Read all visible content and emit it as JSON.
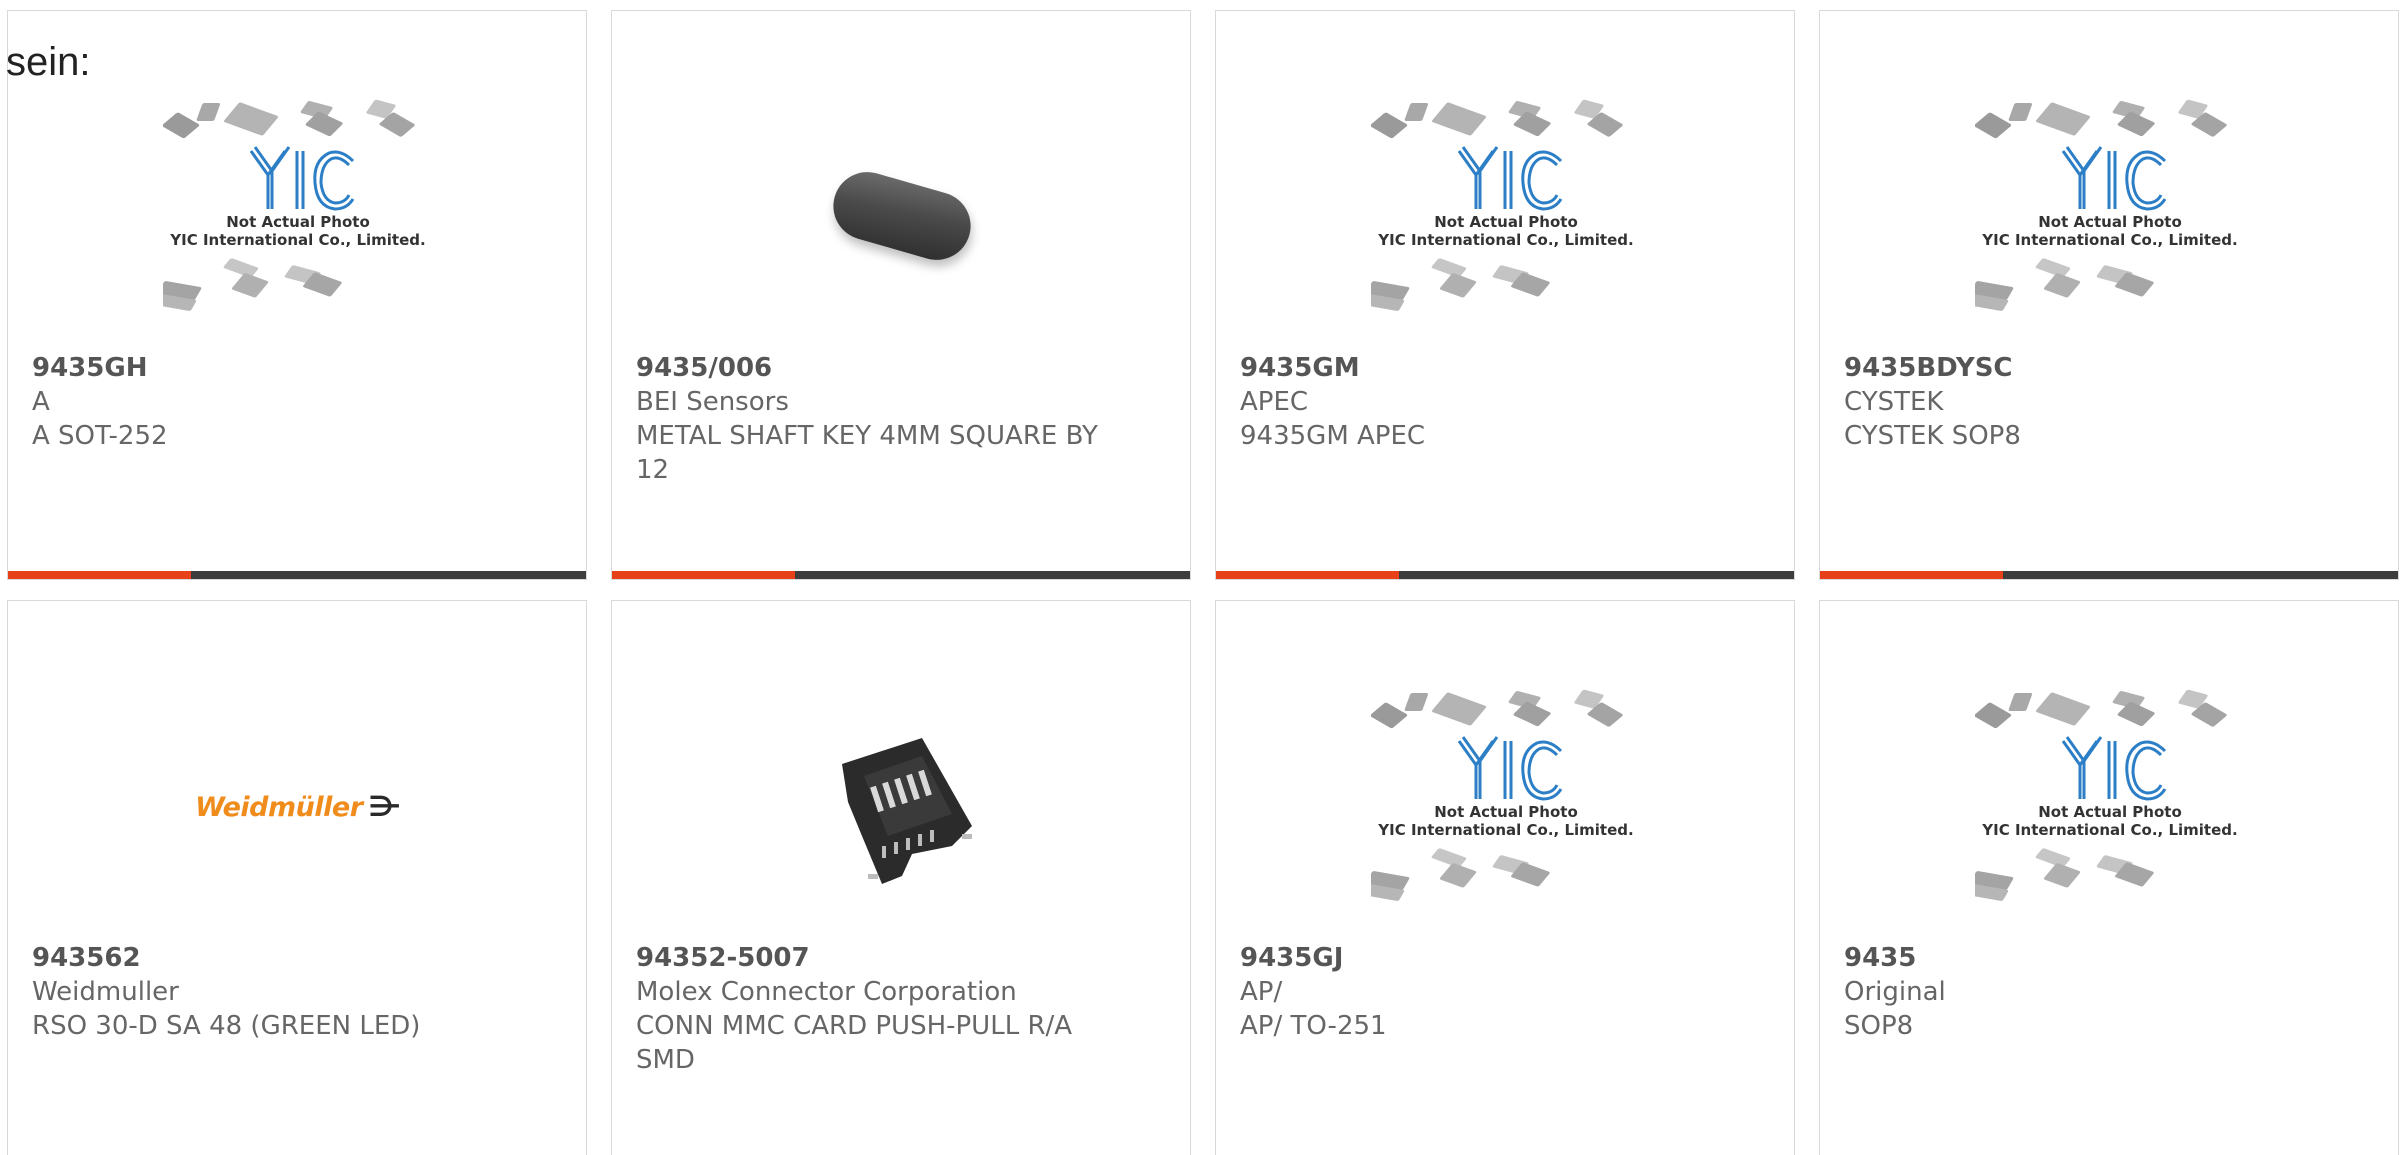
{
  "page": {
    "lead_text": "sein:"
  },
  "placeholder": {
    "line1": "Not Actual Photo",
    "line2": "YIC International Co., Limited.",
    "brand": "YIC"
  },
  "colors": {
    "accent": "#e8411a",
    "bar": "#3d3d3d",
    "text": "#666666"
  },
  "products": [
    {
      "part": "9435GH",
      "maker": "A",
      "desc": "A SOT-252",
      "image": "yic-placeholder"
    },
    {
      "part": "9435/006",
      "maker": "BEI Sensors",
      "desc": "METAL SHAFT KEY 4MM SQUARE BY 12",
      "image": "shaft-key-photo"
    },
    {
      "part": "9435GM",
      "maker": "APEC",
      "desc": "9435GM APEC",
      "image": "yic-placeholder"
    },
    {
      "part": "9435BDYSC",
      "maker": "CYSTEK",
      "desc": "CYSTEK SOP8",
      "image": "yic-placeholder"
    },
    {
      "part": "943562",
      "maker": "Weidmuller",
      "desc": "RSO 30-D SA 48 (GREEN LED)",
      "image": "weidmuller-logo",
      "logo_text": "Weidmüller",
      "logo_mark": "⋺"
    },
    {
      "part": "94352-5007",
      "maker": "Molex Connector Corporation",
      "desc": "CONN MMC CARD PUSH-PULL R/A SMD",
      "image": "connector-photo"
    },
    {
      "part": "9435GJ",
      "maker": "AP/",
      "desc": "AP/ TO-251",
      "image": "yic-placeholder"
    },
    {
      "part": "9435",
      "maker": "Original",
      "desc": "SOP8",
      "image": "yic-placeholder"
    }
  ]
}
